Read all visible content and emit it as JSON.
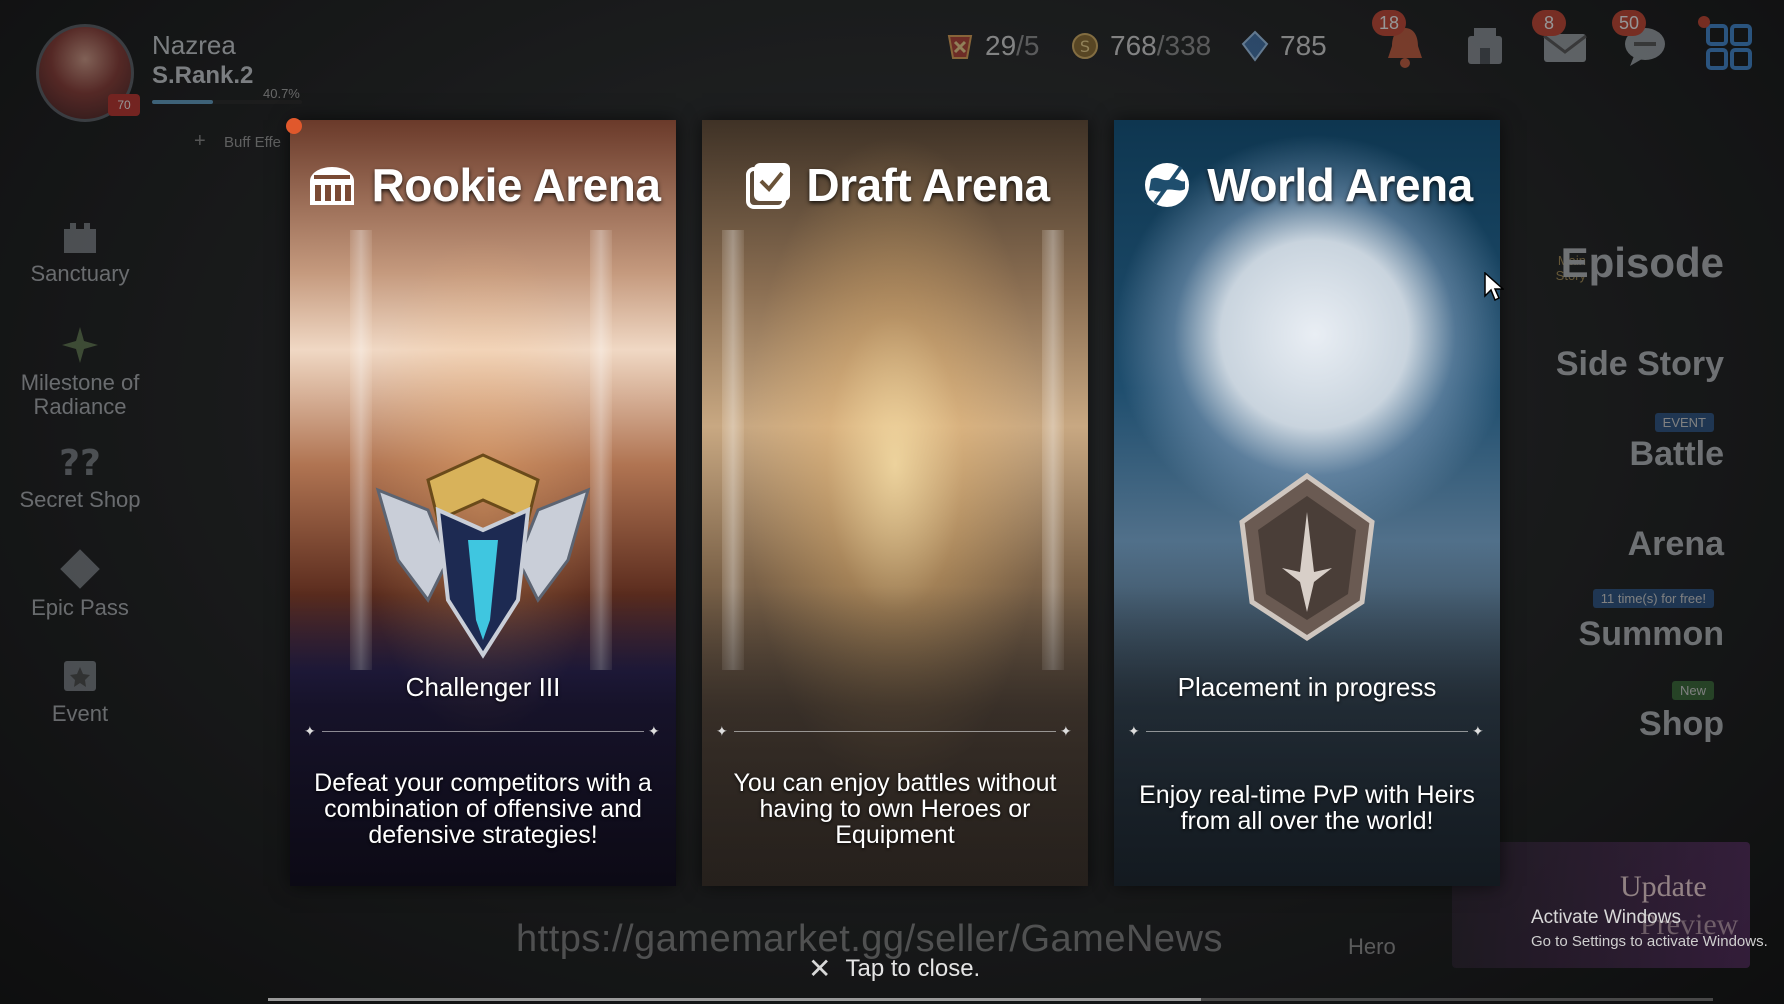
{
  "profile": {
    "name": "Nazrea",
    "rank": "S.Rank.2",
    "level": "70",
    "xp_percent": "40.7%",
    "xp_fraction": 0.407,
    "buff_label": "Buff Effe"
  },
  "currencies": {
    "stamina": {
      "value": "29",
      "max": "/5"
    },
    "gold": {
      "value": "768",
      "max": "/338"
    },
    "gems": {
      "value": "785"
    }
  },
  "top_icons": {
    "notifications_badge": "18",
    "mail_badge": "8",
    "chat_badge": "50"
  },
  "left_menu": [
    {
      "label": "Sanctuary",
      "icon": "castle-icon"
    },
    {
      "label": "Milestone of Radiance",
      "icon": "milestone-icon"
    },
    {
      "label": "Secret Shop",
      "icon": "question-icon"
    },
    {
      "label": "Epic Pass",
      "icon": "pass-icon"
    },
    {
      "label": "Event",
      "icon": "event-icon"
    }
  ],
  "right_menu": {
    "episode_tag": "Main Story",
    "episode": "Episode",
    "side_story": "Side Story",
    "battle_tag": "EVENT",
    "battle": "Battle",
    "arena": "Arena",
    "summon_tag": "11 time(s) for free!",
    "summon": "Summon",
    "shop_tag": "New",
    "shop": "Shop",
    "hero": "Hero",
    "update": "Update",
    "preview": "Preview"
  },
  "cards": [
    {
      "title": "Rookie Arena",
      "icon": "colosseum-icon",
      "rank_label": "Challenger III",
      "description": "Defeat your competitors with a combination of offensive and defensive strategies!"
    },
    {
      "title": "Draft Arena",
      "icon": "checkbox-icon",
      "rank_label": "",
      "description": "You can enjoy battles without having to own Heroes or Equipment"
    },
    {
      "title": "World Arena",
      "icon": "globe-sword-icon",
      "rank_label": "Placement in progress",
      "description": "Enjoy real-time PvP with Heirs from all over the world!"
    }
  ],
  "watermark": "https://gamemarket.gg/seller/GameNews",
  "close_hint": "Tap to close.",
  "os_overlay": {
    "title": "Activate Windows",
    "subtitle": "Go to Settings to activate Windows."
  },
  "colors": {
    "accent_orange": "#e0582c",
    "badge_red": "#c8432f",
    "rookie_emblem": "#3fc6e0",
    "world_emblem": "#6a5a52"
  }
}
